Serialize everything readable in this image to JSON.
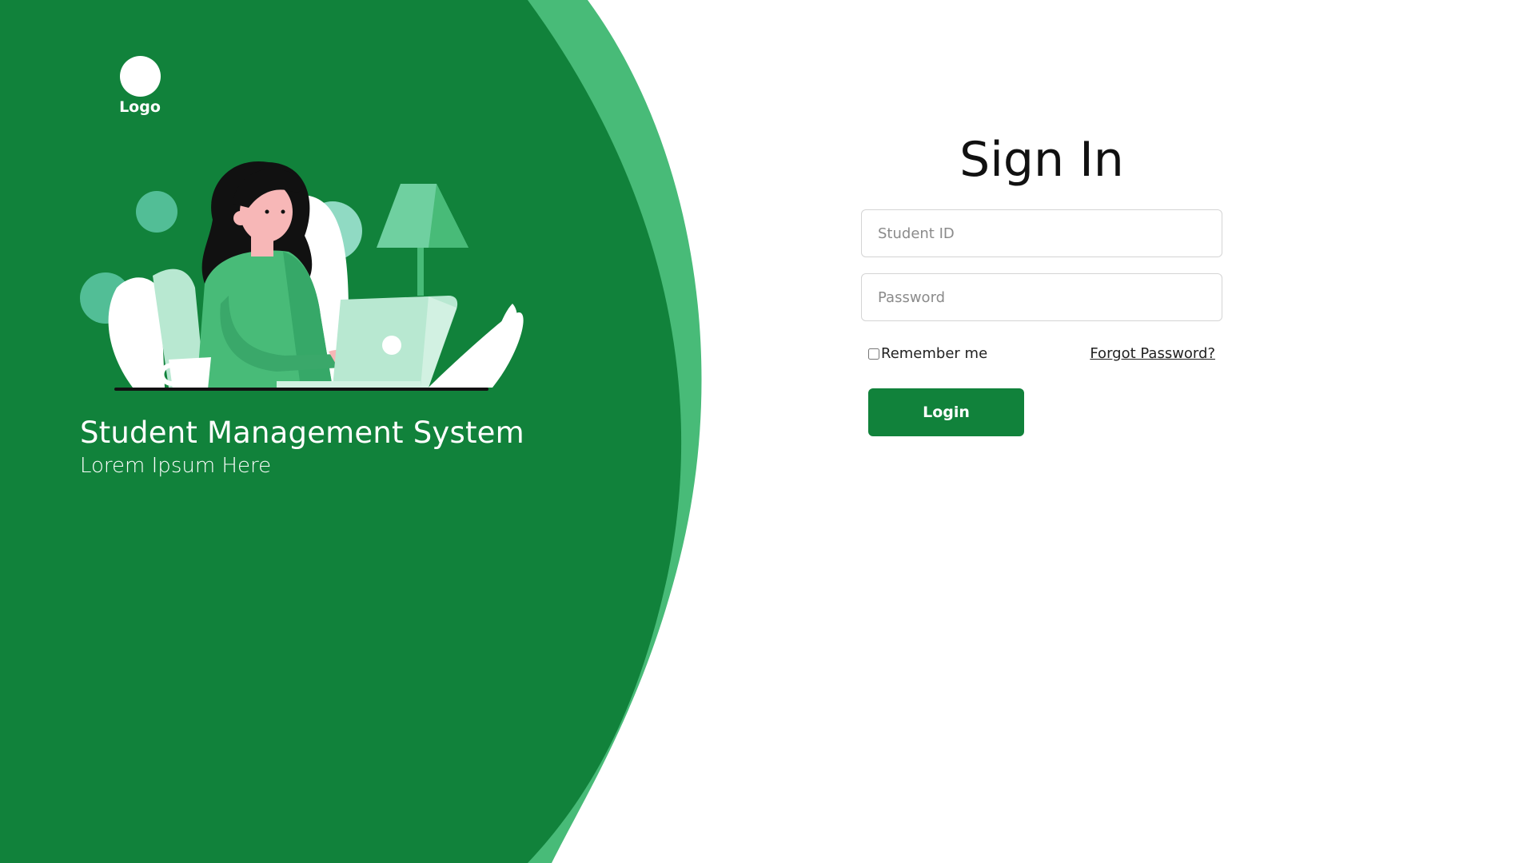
{
  "colors": {
    "primary_green": "#11823b",
    "accent_green": "#48bb78",
    "light_mint": "#b8e8d1",
    "teal_circle": "#52be96",
    "white": "#ffffff",
    "text_dark": "#111111"
  },
  "branding": {
    "logo_label": "Logo",
    "title": "Student Management System",
    "subtitle": "Lorem Ipsum Here",
    "illustration_icon": "woman-working-on-laptop-illustration"
  },
  "form": {
    "title": "Sign In",
    "student_id": {
      "value": "",
      "placeholder": "Student ID"
    },
    "password": {
      "value": "",
      "placeholder": "Password"
    },
    "remember_label": "Remember me",
    "remember_checked": false,
    "forgot_label": "Forgot Password?",
    "login_label": "Login"
  }
}
